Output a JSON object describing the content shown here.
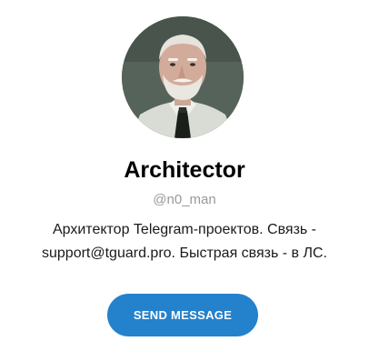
{
  "profile": {
    "name": "Architector",
    "username": "@n0_man",
    "description_line1": "Архитектор Telegram-проектов. Связь -",
    "description_line2": "support@tguard.pro. Быстрая связь - в ЛС.",
    "avatar_icon": "user-avatar-photo"
  },
  "actions": {
    "send_message_label": "SEND MESSAGE"
  },
  "colors": {
    "button_bg": "#2481cc",
    "username_text": "#999999",
    "background": "#ffffff"
  }
}
